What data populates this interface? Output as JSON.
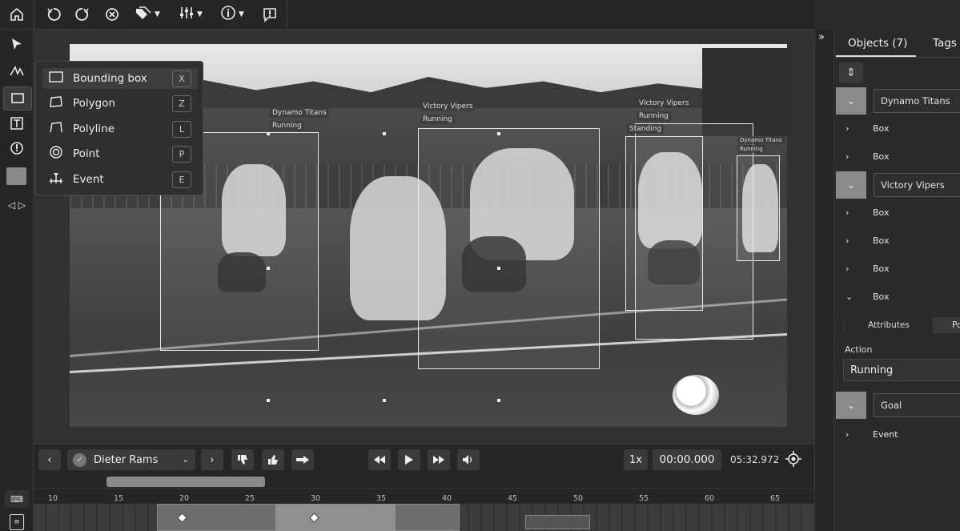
{
  "toolbar": {
    "home_icon": "home-icon",
    "undo_icon": "undo-icon",
    "redo_icon": "redo-icon",
    "reset_icon": "reset-icon",
    "tags_icon": "tags-icon",
    "filters_icon": "sliders-icon",
    "info_icon": "info-icon",
    "issue_icon": "issue-icon"
  },
  "tools_menu": {
    "items": [
      {
        "label": "Bounding box",
        "key": "X",
        "icon": "bounding-box-icon"
      },
      {
        "label": "Polygon",
        "key": "Z",
        "icon": "polygon-icon"
      },
      {
        "label": "Polyline",
        "key": "L",
        "icon": "polyline-icon"
      },
      {
        "label": "Point",
        "key": "P",
        "icon": "point-icon"
      },
      {
        "label": "Event",
        "key": "E",
        "icon": "event-icon"
      }
    ]
  },
  "annotations": [
    {
      "group": "Dynamo Titans",
      "action": "Running"
    },
    {
      "group": "Victory Vipers",
      "action": "Running"
    },
    {
      "group": "Victory Vipers",
      "action": "Running"
    },
    {
      "group": "Victory Vipers",
      "action": "Standing"
    },
    {
      "group": "Dynamo Titans",
      "action": "Running"
    }
  ],
  "player": {
    "user": "Dieter Rams",
    "speed": "1x",
    "current_time": "00:00.000",
    "duration": "05:32.972"
  },
  "timeline": {
    "ticks": [
      "10",
      "15",
      "20",
      "25",
      "30",
      "35",
      "40",
      "45",
      "50",
      "55",
      "60",
      "65"
    ]
  },
  "right_panel": {
    "tabs": [
      "Objects (7)",
      "Tags"
    ],
    "groups": [
      {
        "name": "Dynamo Titans",
        "objects": [
          "Box",
          "Box"
        ]
      },
      {
        "name": "Victory Vipers",
        "objects": [
          "Box",
          "Box",
          "Box",
          "Box"
        ]
      },
      {
        "name": "Goal",
        "objects": [
          "Event"
        ]
      }
    ],
    "attribute_tabs": [
      "Attributes",
      "Po"
    ],
    "action_label": "Action",
    "action_value": "Running"
  },
  "colors": {
    "panel_bg": "#2a2a2a",
    "toolbar_bg": "#262626",
    "group_chevron": "#8a8a8a"
  }
}
